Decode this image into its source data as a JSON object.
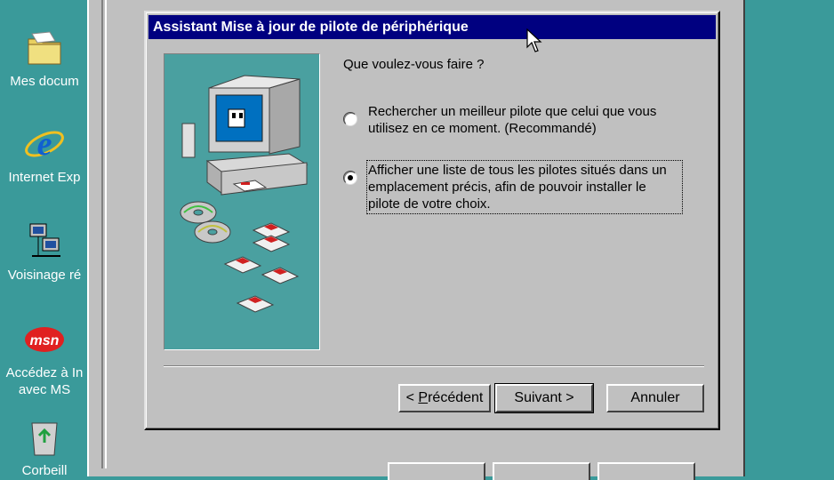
{
  "desktop": {
    "icons": [
      {
        "name": "my-documents-icon",
        "label": "Mes docum"
      },
      {
        "name": "internet-explorer-icon",
        "label": "Internet Exp"
      },
      {
        "name": "network-neighborhood-icon",
        "label": "Voisinage ré"
      },
      {
        "name": "msn-icon",
        "label_line1": "Accédez à In",
        "label_line2": "avec MS"
      },
      {
        "name": "recycle-bin-icon",
        "label": "Corbeill"
      }
    ]
  },
  "dialog": {
    "title": "Assistant Mise à jour de pilote de périphérique",
    "question": "Que voulez-vous faire ?",
    "options": [
      {
        "label": "Rechercher un meilleur pilote que celui que vous utilisez en ce moment. (Recommandé)",
        "checked": false
      },
      {
        "label": "Afficher une liste de tous les pilotes situés dans un emplacement précis, afin de pouvoir installer le pilote de votre choix.",
        "checked": true
      }
    ],
    "buttons": {
      "back_prefix": "< ",
      "back_underlined": "P",
      "back_rest": "récédent",
      "next": "Suivant >",
      "cancel": "Annuler"
    }
  },
  "colors": {
    "desktop": "#3a9a9a",
    "titlebar": "#000080",
    "face": "#c0c0c0",
    "art_background": "#4aa0a0"
  }
}
